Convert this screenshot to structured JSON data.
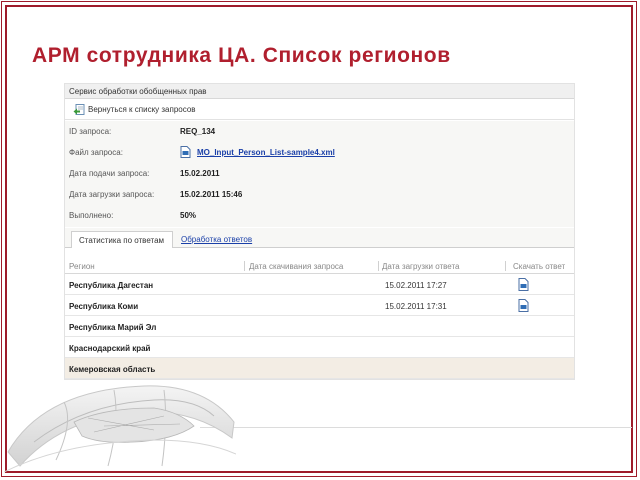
{
  "slide": {
    "title": "АРМ сотрудника ЦА. Список регионов"
  },
  "service_header": {
    "title": "Сервис обработки обобщенных прав"
  },
  "back_link": {
    "label": "Вернуться к списку запросов"
  },
  "request_info": {
    "id_label": "ID запроса:",
    "id_value": "REQ_134",
    "file_label": "Файл запроса:",
    "file_value": "MO_Input_Person_List-sample4.xml",
    "submit_label": "Дата подачи запроса:",
    "submit_value": "15.02.2011",
    "upload_label": "Дата загрузки запроса:",
    "upload_value": "15.02.2011 15:46",
    "done_label": "Выполнено:",
    "done_value": "50%"
  },
  "tabs": {
    "stats": "Статистика по ответам",
    "processing": "Обработка ответов"
  },
  "table": {
    "headers": {
      "region": "Регион",
      "download_date": "Дата скачивания запроса",
      "upload_date": "Дата загрузки ответа",
      "download_answer": "Скачать ответ"
    },
    "rows": [
      {
        "region": "Республика Дагестан",
        "upload_date": "15.02.2011 17:27",
        "has_file": true
      },
      {
        "region": "Республика Коми",
        "upload_date": "15.02.2011 17:31",
        "has_file": true
      },
      {
        "region": "Республика Марий Эл",
        "upload_date": "",
        "has_file": false
      },
      {
        "region": "Краснодарский край",
        "upload_date": "",
        "has_file": false
      },
      {
        "region": "Кемеровская область",
        "upload_date": "",
        "has_file": false
      }
    ]
  },
  "colors": {
    "frame": "#9e1b2a",
    "title": "#b01f2e",
    "link": "#1a3fa8",
    "highlight_row": "#f3ede4"
  },
  "icons": {
    "back": "back-arrow-icon",
    "file": "xml-file-icon",
    "download": "download-file-icon",
    "decoration": "globe-map-icon"
  }
}
